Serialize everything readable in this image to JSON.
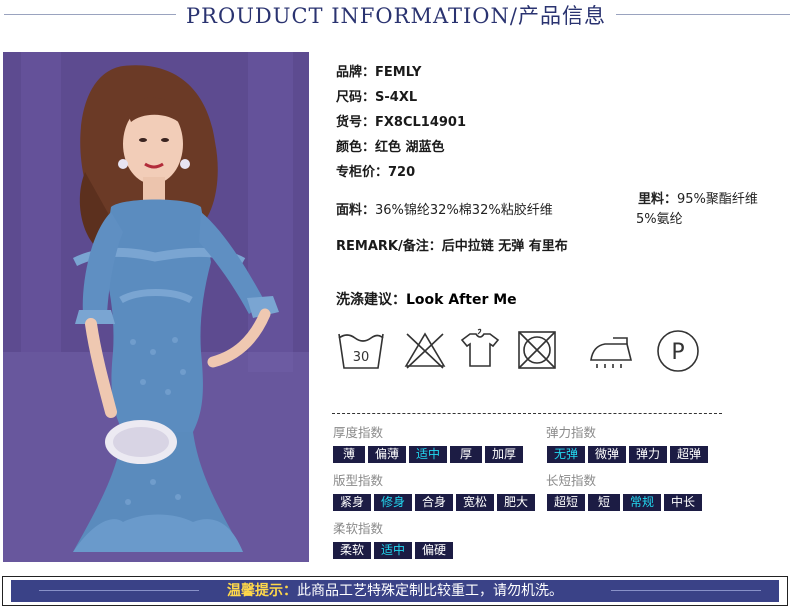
{
  "header": {
    "title": "PROUDUCT INFORMATION/产品信息"
  },
  "product": {
    "brand": {
      "label": "品牌：",
      "value": "FEMLY"
    },
    "size": {
      "label": "尺码：",
      "value": "S-4XL"
    },
    "item_no": {
      "label": "货号：",
      "value": "FX8CL14901"
    },
    "color": {
      "label": "颜色：",
      "value": "红色 湖蓝色"
    },
    "price": {
      "label": "专柜价：",
      "value": "720"
    },
    "fabric": {
      "label": "面料：",
      "value": "36%锦纶32%棉32%粘胶纤维"
    },
    "lining": {
      "label": "里料：",
      "value": "95%聚酯纤维",
      "value2": "5%氨纶"
    },
    "remark": {
      "label": "REMARK/备注：",
      "value": "后中拉链 无弹 有里布"
    },
    "wash": {
      "label": "洗涤建议：",
      "value": "Look After Me"
    }
  },
  "care_icons": {
    "wash_temp": "30",
    "press_symbol": "P",
    "names": [
      "wash-30-icon",
      "no-bleach-icon",
      "hang-dry-icon",
      "no-tumble-dry-icon",
      "iron-icon",
      "dry-clean-p-icon"
    ]
  },
  "indices": {
    "thickness": {
      "title": "厚度指数",
      "options": [
        "薄",
        "偏薄",
        "适中",
        "厚",
        "加厚"
      ],
      "selected": 2
    },
    "elasticity": {
      "title": "弹力指数",
      "options": [
        "无弹",
        "微弹",
        "弹力",
        "超弹"
      ],
      "selected": 0
    },
    "fit": {
      "title": "版型指数",
      "options": [
        "紧身",
        "修身",
        "合身",
        "宽松",
        "肥大"
      ],
      "selected": 1
    },
    "length": {
      "title": "长短指数",
      "options": [
        "超短",
        "短",
        "常规",
        "中长"
      ],
      "selected": 2
    },
    "softness": {
      "title": "柔软指数",
      "options": [
        "柔软",
        "适中",
        "偏硬"
      ],
      "selected": 1
    }
  },
  "notice": {
    "highlight": "温馨提示：",
    "text": "此商品工艺特殊定制比较重工，请勿机洗。"
  },
  "colors": {
    "navy": "#1c1c44",
    "selected_text": "#22d8f0",
    "banner": "#3a4287",
    "title": "#2a3370"
  }
}
